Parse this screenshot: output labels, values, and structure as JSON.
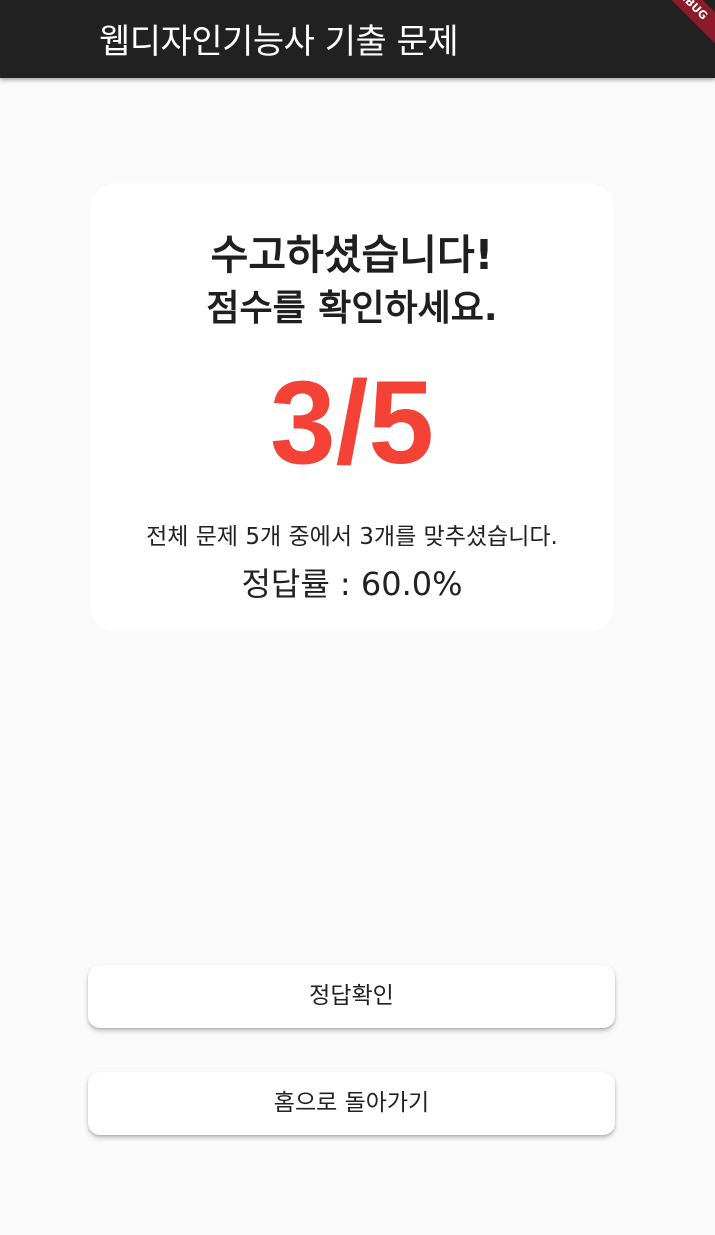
{
  "appbar": {
    "title": "웹디자인기능사 기출 문제",
    "background": "#212121",
    "debug_banner": "DEBUG"
  },
  "result_card": {
    "headline_line1": "수고하셨습니다!",
    "headline_line2": "점수를 확인하세요.",
    "score_text": "3/5",
    "score_color": "#f44336",
    "summary": "전체 문제 5개 중에서 3개를 맞추셨습니다.",
    "rate_text": "정답률 : 60.0%",
    "correct": 3,
    "total": 5,
    "rate_percent": 60.0
  },
  "actions": {
    "check_answers_label": "정답확인",
    "go_home_label": "홈으로 돌아가기"
  }
}
